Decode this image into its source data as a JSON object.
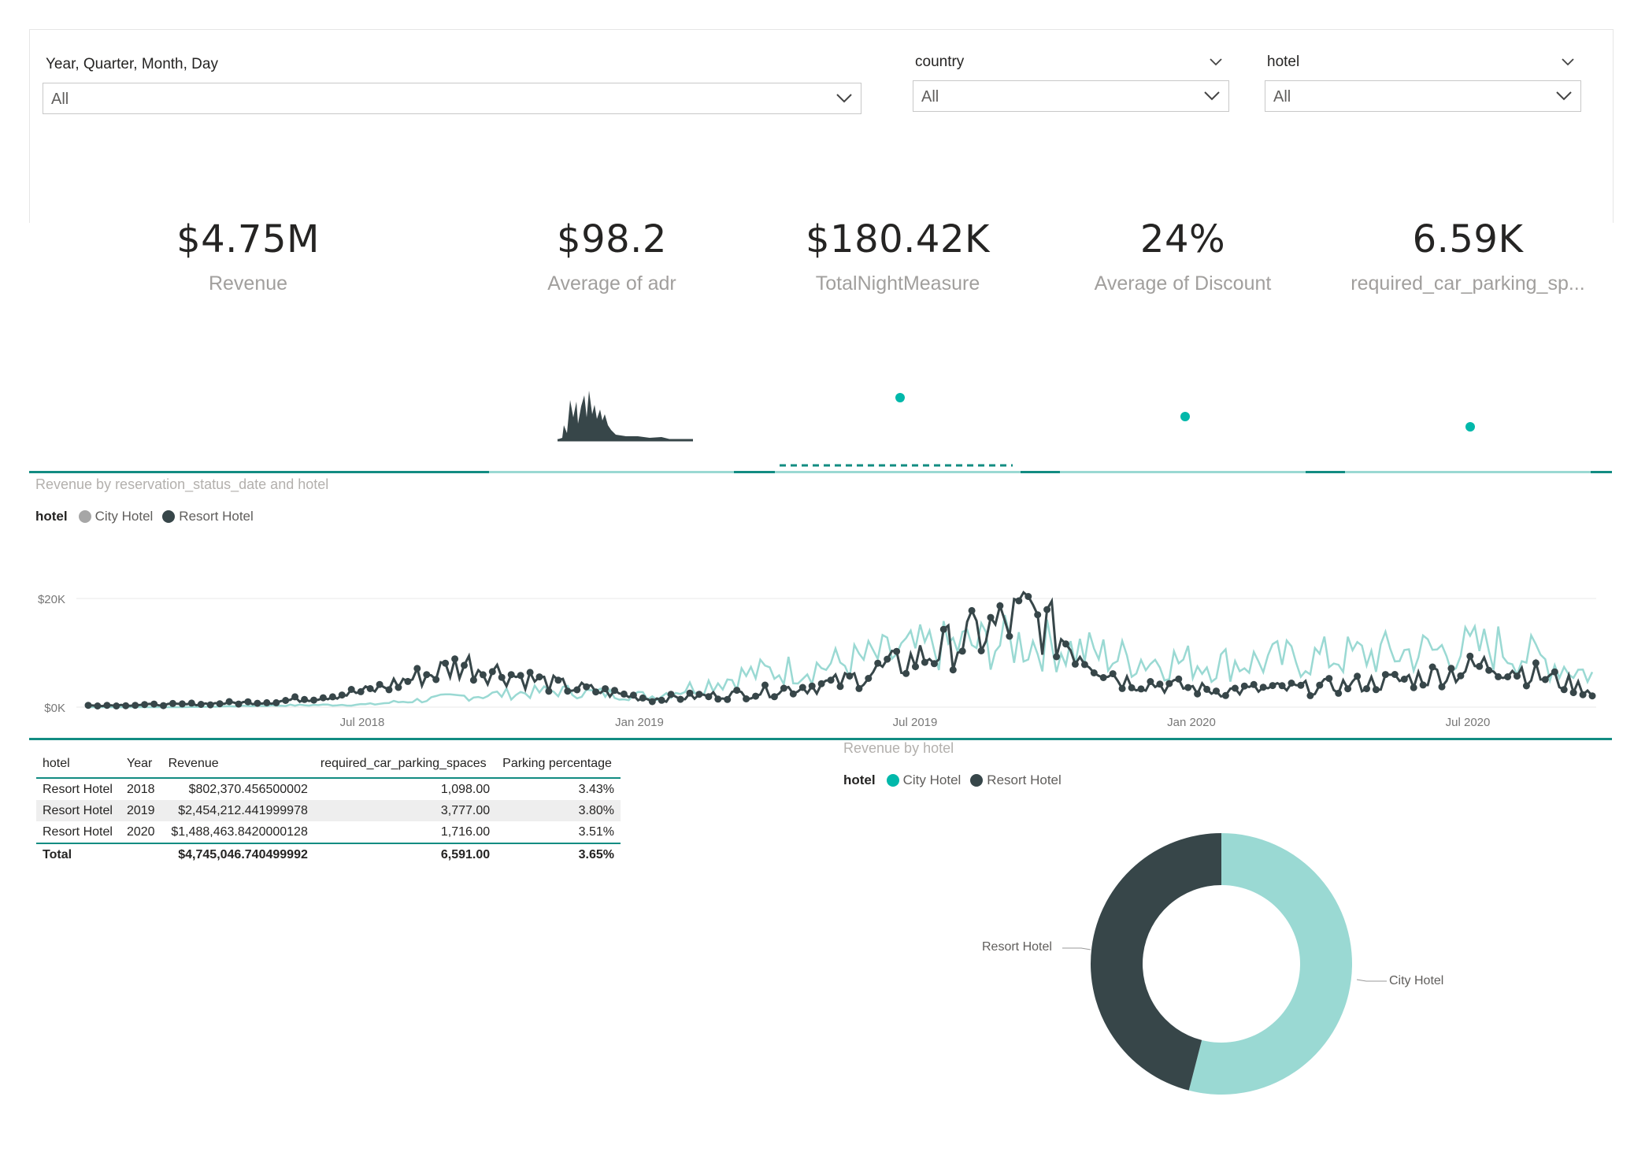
{
  "slicers": {
    "date": {
      "title": "Year, Quarter, Month, Day",
      "value": "All"
    },
    "country": {
      "title": "country",
      "value": "All"
    },
    "hotel": {
      "title": "hotel",
      "value": "All"
    }
  },
  "kpis": [
    {
      "value": "$4.75M",
      "label": "Revenue"
    },
    {
      "value": "$98.2",
      "label": "Average of adr"
    },
    {
      "value": "$180.42K",
      "label": "TotalNightMeasure"
    },
    {
      "value": "24%",
      "label": "Average of Discount"
    },
    {
      "value": "6.59K",
      "label": "required_car_parking_sp..."
    }
  ],
  "colors": {
    "accent": "#128c82",
    "city_hotel": "#9ad9d3",
    "resort_hotel": "#374649",
    "city_legend_line": "#a6a6a6",
    "city_legend_donut": "#01b8aa"
  },
  "line_chart": {
    "title": "Revenue by reservation_status_date and hotel",
    "legend_title": "hotel",
    "legend_items": [
      "City Hotel",
      "Resort Hotel"
    ],
    "y_ticks": [
      "$20K",
      "$0K"
    ],
    "x_ticks": [
      "Jul 2018",
      "Jan 2019",
      "Jul 2019",
      "Jan 2020",
      "Jul 2020"
    ]
  },
  "table": {
    "headers": [
      "hotel",
      "Year",
      "Revenue",
      "required_car_parking_spaces",
      "Parking percentage"
    ],
    "rows": [
      [
        "Resort Hotel",
        "2018",
        "$802,370.456500002",
        "1,098.00",
        "3.43%"
      ],
      [
        "Resort Hotel",
        "2019",
        "$2,454,212.441999978",
        "3,777.00",
        "3.80%"
      ],
      [
        "Resort Hotel",
        "2020",
        "$1,488,463.8420000128",
        "1,716.00",
        "3.51%"
      ]
    ],
    "total": [
      "Total",
      "",
      "$4,745,046.740499992",
      "6,591.00",
      "3.65%"
    ]
  },
  "donut": {
    "title": "Revenue by hotel",
    "legend_title": "hotel",
    "legend_items": [
      "City Hotel",
      "Resort Hotel"
    ],
    "labels": {
      "resort": "Resort Hotel",
      "city": "City Hotel"
    }
  },
  "chart_data": [
    {
      "type": "line",
      "title": "Revenue by reservation_status_date and hotel",
      "xlabel": "",
      "ylabel": "",
      "x_ticks": [
        "Jul 2018",
        "Jan 2019",
        "Jul 2019",
        "Jan 2020",
        "Jul 2020"
      ],
      "ylim": [
        0,
        25000
      ],
      "x": [
        "2018-01",
        "2018-03",
        "2018-05",
        "2018-07",
        "2018-09",
        "2018-11",
        "2019-01",
        "2019-03",
        "2019-05",
        "2019-07",
        "2019-09",
        "2019-11",
        "2020-01",
        "2020-03",
        "2020-05",
        "2020-07",
        "2020-09"
      ],
      "series": [
        {
          "name": "City Hotel",
          "values": [
            0,
            0,
            300,
            500,
            2000,
            3000,
            2000,
            6000,
            8000,
            11000,
            12000,
            9000,
            8000,
            9000,
            10000,
            11000,
            6000
          ]
        },
        {
          "name": "Resort Hotel",
          "values": [
            300,
            500,
            1000,
            3000,
            8000,
            4000,
            1500,
            2500,
            4500,
            10000,
            17000,
            5000,
            3000,
            3500,
            5000,
            8000,
            3000
          ]
        }
      ]
    },
    {
      "type": "pie",
      "title": "Revenue by hotel",
      "categories": [
        "City Hotel",
        "Resort Hotel"
      ],
      "values": [
        54,
        46
      ]
    }
  ]
}
